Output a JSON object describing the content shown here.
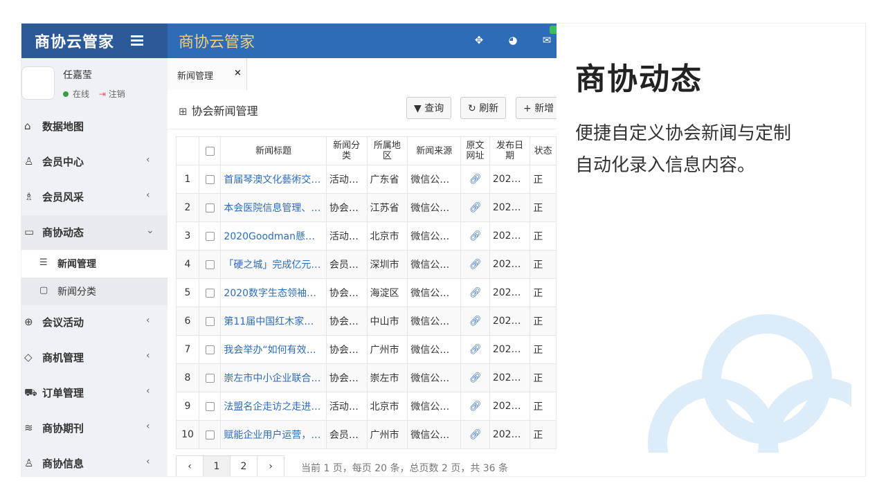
{
  "brand": {
    "logo": "商协云管家"
  },
  "topbar": {
    "title": "商协云管家",
    "icons": [
      "expand-icon",
      "dashboard-icon",
      "mail-icon"
    ],
    "accent": "#2f6cb8"
  },
  "user": {
    "name": "任嘉莹",
    "status": "在线",
    "logout": "注销"
  },
  "sidebar": {
    "items": [
      {
        "label": "数据地图",
        "icon": "home-icon"
      },
      {
        "label": "会员中心",
        "icon": "user-icon"
      },
      {
        "label": "会员风采",
        "icon": "users-icon"
      },
      {
        "label": "商协动态",
        "icon": "message-icon"
      },
      {
        "label": "会议活动",
        "icon": "globe-icon"
      },
      {
        "label": "商机管理",
        "icon": "diamond-icon"
      },
      {
        "label": "订单管理",
        "icon": "cart-icon"
      },
      {
        "label": "商协期刊",
        "icon": "layers-icon"
      },
      {
        "label": "商协信息",
        "icon": "user-icon"
      }
    ],
    "sub_items": [
      {
        "label": "新闻管理",
        "icon": "list-icon"
      },
      {
        "label": "新闻分类",
        "icon": "calendar-icon"
      }
    ]
  },
  "tab": {
    "label": "新闻管理",
    "close": "×"
  },
  "panel": {
    "title": "协会新闻管理",
    "buttons": {
      "query": "查询",
      "refresh": "刷新",
      "add": "新增"
    }
  },
  "table": {
    "headers": [
      "新闻标题",
      "新闻分类",
      "所属地区",
      "新闻来源",
      "原文网址",
      "发布日期",
      "状态"
    ],
    "rows": [
      {
        "no": "1",
        "title": "首届琴澳文化藝術交…",
        "cat": "活动…",
        "region": "广东省",
        "source": "微信公…",
        "date": "202…",
        "status": "正"
      },
      {
        "no": "2",
        "title": "本会医院信息管理、…",
        "cat": "协会…",
        "region": "江苏省",
        "source": "微信公…",
        "date": "202…",
        "status": "正"
      },
      {
        "no": "3",
        "title": "2020Goodman懸…",
        "cat": "活动…",
        "region": "北京市",
        "source": "微信公…",
        "date": "202…",
        "status": "正"
      },
      {
        "no": "4",
        "title": "「硬之城」完成亿元…",
        "cat": "会员…",
        "region": "深圳市",
        "source": "微信公…",
        "date": "202…",
        "status": "正"
      },
      {
        "no": "5",
        "title": "2020数字生态领袖…",
        "cat": "协会…",
        "region": "海淀区",
        "source": "微信公…",
        "date": "202…",
        "status": "正"
      },
      {
        "no": "6",
        "title": "第11届中国红木家…",
        "cat": "协会…",
        "region": "中山市",
        "source": "微信公…",
        "date": "202…",
        "status": "正"
      },
      {
        "no": "7",
        "title": "我会举办“如何有效…",
        "cat": "协会…",
        "region": "广州市",
        "source": "微信公…",
        "date": "202…",
        "status": "正"
      },
      {
        "no": "8",
        "title": "崇左市中小企业联合…",
        "cat": "协会…",
        "region": "崇左市",
        "source": "微信公…",
        "date": "202…",
        "status": "正"
      },
      {
        "no": "9",
        "title": "法盟名企走访之走进…",
        "cat": "活动…",
        "region": "北京市",
        "source": "微信公…",
        "date": "202…",
        "status": "正"
      },
      {
        "no": "10",
        "title": "赋能企业用户运营，…",
        "cat": "会员…",
        "region": "广州市",
        "source": "微信公…",
        "date": "202…",
        "status": "正"
      }
    ]
  },
  "pager": {
    "prev": "‹",
    "pages": [
      "1",
      "2"
    ],
    "next": "›",
    "info": "当前  1  页，每页  20  条，总页数 2 页，共 36 条"
  },
  "side": {
    "heading": "商协动态",
    "description": "便捷自定义协会新闻与定制自动化录入信息内容。"
  }
}
